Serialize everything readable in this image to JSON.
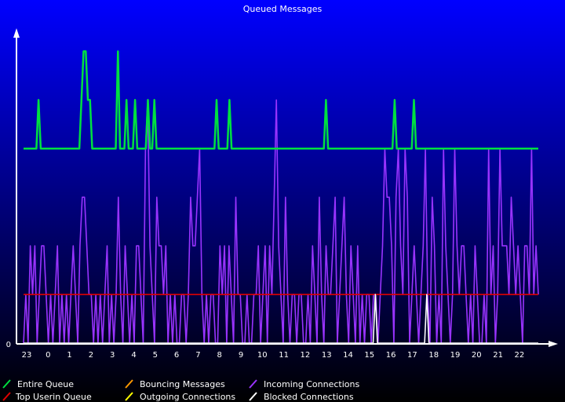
{
  "chart_data": {
    "type": "line",
    "title": "Queued Messages",
    "xlabel": "",
    "ylabel": "",
    "y_tick_labels": [
      "0"
    ],
    "x_tick_labels": [
      "23",
      "0",
      "1",
      "2",
      "3",
      "4",
      "5",
      "6",
      "7",
      "8",
      "9",
      "10",
      "11",
      "12",
      "13",
      "14",
      "15",
      "16",
      "17",
      "18",
      "19",
      "20",
      "21",
      "22"
    ],
    "xlim": [
      0,
      240
    ],
    "ylim": [
      0,
      6.2
    ],
    "grid": false,
    "legend_position": "bottom",
    "series": [
      {
        "name": "Entire Queue",
        "color": "#00e040",
        "points": [
          [
            0,
            4
          ],
          [
            6,
            4
          ],
          [
            7,
            5
          ],
          [
            8,
            4
          ],
          [
            26,
            4
          ],
          [
            27,
            5
          ],
          [
            28,
            6
          ],
          [
            29,
            6
          ],
          [
            30,
            5
          ],
          [
            31,
            5
          ],
          [
            32,
            4
          ],
          [
            43,
            4
          ],
          [
            44,
            6
          ],
          [
            45,
            4
          ],
          [
            47,
            4
          ],
          [
            48,
            5
          ],
          [
            49,
            4
          ],
          [
            51,
            4
          ],
          [
            52,
            5
          ],
          [
            53,
            4
          ],
          [
            57,
            4
          ],
          [
            58,
            5
          ],
          [
            59,
            4
          ],
          [
            60,
            4
          ],
          [
            61,
            5
          ],
          [
            62,
            4
          ],
          [
            89,
            4
          ],
          [
            90,
            5
          ],
          [
            91,
            4
          ],
          [
            95,
            4
          ],
          [
            96,
            5
          ],
          [
            97,
            4
          ],
          [
            140,
            4
          ],
          [
            141,
            5
          ],
          [
            142,
            4
          ],
          [
            172,
            4
          ],
          [
            173,
            5
          ],
          [
            174,
            4
          ],
          [
            181,
            4
          ],
          [
            182,
            5
          ],
          [
            183,
            4
          ],
          [
            240,
            4
          ]
        ]
      },
      {
        "name": "Top Userin Queue",
        "color": "#e00000",
        "points": [
          [
            0,
            1
          ],
          [
            240,
            1
          ]
        ]
      },
      {
        "name": "Bouncing Messages",
        "color": "#ff9900",
        "points": []
      },
      {
        "name": "Outgoing Connections",
        "color": "#ffff00",
        "points": []
      },
      {
        "name": "Incoming Connections",
        "color": "#9933ff",
        "values": [
          0,
          1,
          0,
          2,
          1,
          2,
          0,
          1,
          2,
          2,
          1,
          0,
          1,
          0,
          1,
          2,
          0,
          1,
          0,
          1,
          0,
          1,
          2,
          1,
          0,
          2,
          3,
          3,
          2,
          1,
          1,
          0,
          1,
          0,
          1,
          0,
          1,
          2,
          0,
          1,
          0,
          1,
          3,
          1,
          0,
          2,
          1,
          0,
          1,
          0,
          2,
          2,
          1,
          0,
          4,
          5,
          2,
          1,
          0,
          3,
          2,
          2,
          1,
          2,
          0,
          1,
          0,
          1,
          0,
          0,
          1,
          1,
          0,
          1,
          3,
          2,
          2,
          3,
          4,
          1,
          0,
          1,
          0,
          1,
          1,
          0,
          0,
          2,
          1,
          2,
          0,
          2,
          1,
          0,
          3,
          1,
          1,
          0,
          0,
          1,
          0,
          0,
          1,
          1,
          2,
          0,
          1,
          2,
          0,
          2,
          1,
          3,
          5,
          2,
          1,
          0,
          3,
          1,
          0,
          1,
          1,
          0,
          1,
          1,
          0,
          0,
          1,
          0,
          2,
          1,
          0,
          3,
          1,
          0,
          2,
          1,
          1,
          2,
          3,
          0,
          1,
          2,
          3,
          1,
          0,
          2,
          1,
          0,
          2,
          0,
          1,
          0,
          1,
          1,
          0,
          1,
          1,
          0,
          1,
          2,
          4,
          3,
          3,
          2,
          0,
          3,
          4,
          2,
          1,
          4,
          3,
          0,
          1,
          2,
          1,
          0,
          1,
          2,
          4,
          1,
          0,
          3,
          2,
          0,
          1,
          0,
          4,
          2,
          1,
          0,
          1,
          4,
          2,
          1,
          2,
          2,
          1,
          0,
          1,
          0,
          2,
          1,
          0,
          0,
          1,
          0,
          4,
          1,
          2,
          0,
          1,
          4,
          2,
          2,
          2,
          1,
          3,
          2,
          1,
          2,
          1,
          0,
          2,
          2,
          1,
          4,
          1,
          2,
          1
        ]
      },
      {
        "name": "Blocked Connections",
        "color": "#ffffff",
        "points": [
          [
            0,
            0
          ],
          [
            163,
            0
          ],
          [
            164,
            1
          ],
          [
            165,
            0
          ],
          [
            187,
            0
          ],
          [
            188,
            1
          ],
          [
            189,
            0
          ],
          [
            240,
            0
          ]
        ]
      }
    ]
  }
}
